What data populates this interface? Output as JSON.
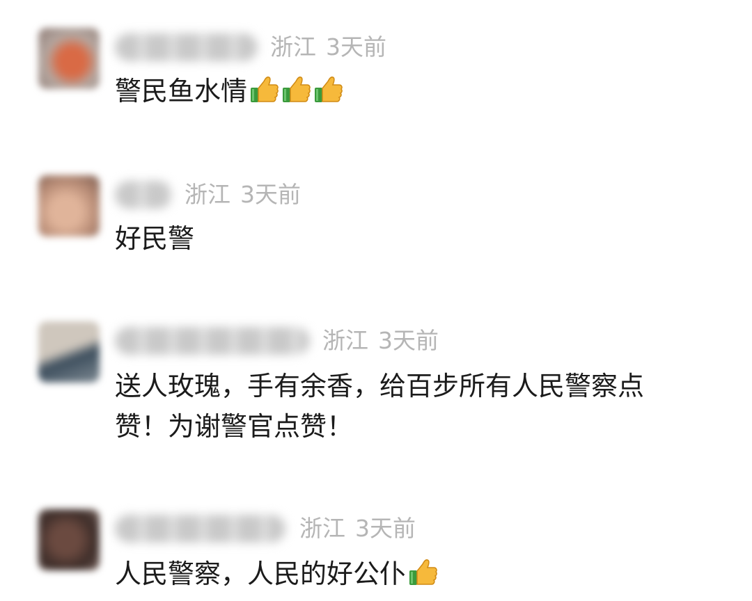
{
  "comments": [
    {
      "location": "浙江",
      "time": "3天前",
      "text": "警民鱼水情",
      "emoji": [
        "thumbs-up",
        "thumbs-up",
        "thumbs-up"
      ],
      "avatar_color": "#b07d6e"
    },
    {
      "location": "浙江",
      "time": "3天前",
      "text": "好民警",
      "emoji": [],
      "avatar_color": "#b58a70"
    },
    {
      "location": "浙江",
      "time": "3天前",
      "text_line1": "送人玫瑰，手有余香，给百步所有人民警察点",
      "text_line2": "赞！为谢警官点赞！",
      "emoji": [],
      "avatar_color": "#9d9487"
    },
    {
      "location": "浙江",
      "time": "3天前",
      "text": "人民警察，人民的好公仆",
      "emoji": [
        "thumbs-up"
      ],
      "avatar_color": "#5e4a44"
    }
  ]
}
